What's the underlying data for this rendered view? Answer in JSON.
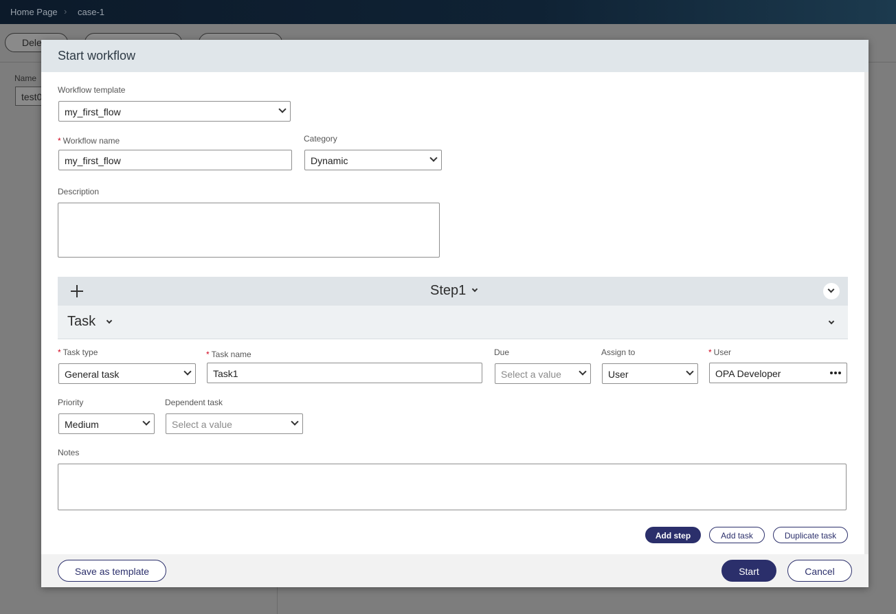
{
  "breadcrumb": {
    "home": "Home Page",
    "current": "case-1",
    "separator": "›"
  },
  "background": {
    "buttons": [
      "Dele",
      "",
      ""
    ],
    "name_label": "Name",
    "name_value": "test0"
  },
  "modal": {
    "title": "Start workflow",
    "workflow_template": {
      "label": "Workflow template",
      "value": "my_first_flow"
    },
    "workflow_name": {
      "label": "Workflow name",
      "value": "my_first_flow"
    },
    "category": {
      "label": "Category",
      "value": "Dynamic"
    },
    "description": {
      "label": "Description",
      "value": ""
    },
    "step": {
      "title": "Step1"
    },
    "task": {
      "title": "Task",
      "task_type": {
        "label": "Task type",
        "value": "General task"
      },
      "task_name": {
        "label": "Task name",
        "value": "Task1"
      },
      "due": {
        "label": "Due",
        "placeholder": "Select a value"
      },
      "assign_to": {
        "label": "Assign to",
        "value": "User"
      },
      "user": {
        "label": "User",
        "value": "OPA Developer"
      },
      "priority": {
        "label": "Priority",
        "value": "Medium"
      },
      "dependent_task": {
        "label": "Dependent task",
        "placeholder": "Select a value"
      },
      "notes": {
        "label": "Notes",
        "value": ""
      }
    },
    "actions": {
      "add_step": "Add step",
      "add_task": "Add task",
      "duplicate_task": "Duplicate task"
    },
    "footer": {
      "save_template": "Save as template",
      "start": "Start",
      "cancel": "Cancel"
    }
  },
  "colors": {
    "primary": "#2b2f6b",
    "required": "#d0021b",
    "header_bg": "#e0e6ea"
  }
}
